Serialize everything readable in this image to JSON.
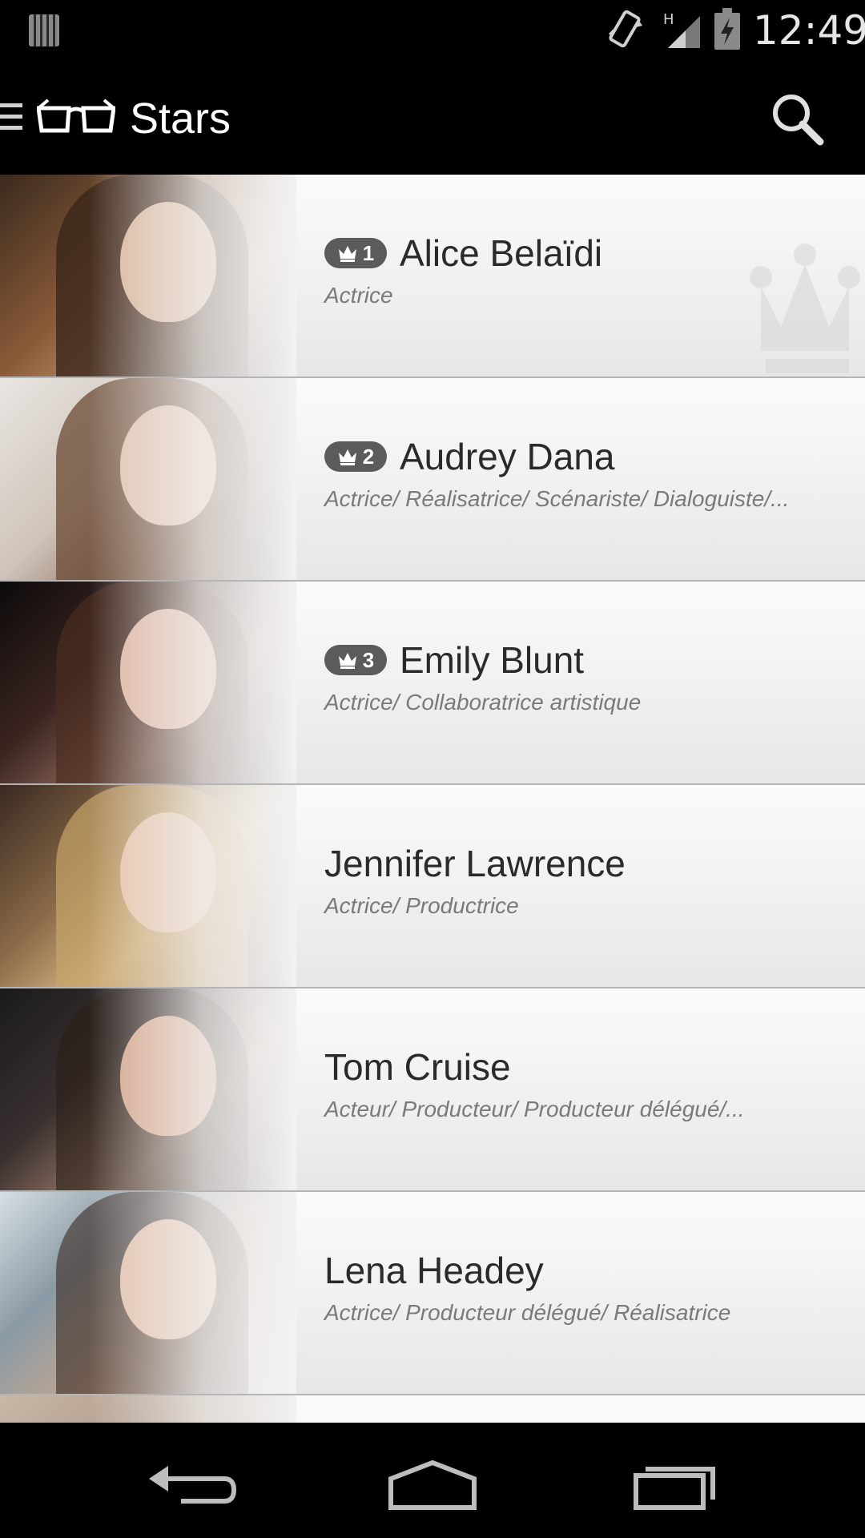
{
  "status_bar": {
    "time": "12:49",
    "network_type": "H",
    "icons": [
      "notification-icon",
      "vibrate-icon",
      "signal-icon",
      "battery-charging-icon"
    ]
  },
  "action_bar": {
    "title": "Stars",
    "icons": [
      "drawer-icon",
      "glasses-logo-icon",
      "search-icon"
    ]
  },
  "stars": [
    {
      "rank": "1",
      "name": "Alice Belaïdi",
      "job": "Actrice"
    },
    {
      "rank": "2",
      "name": "Audrey Dana",
      "job": "Actrice/ Réalisatrice/ Scénariste/ Dialoguiste/..."
    },
    {
      "rank": "3",
      "name": "Emily Blunt",
      "job": "Actrice/ Collaboratrice artistique"
    },
    {
      "rank": "",
      "name": "Jennifer Lawrence",
      "job": "Actrice/ Productrice"
    },
    {
      "rank": "",
      "name": "Tom Cruise",
      "job": "Acteur/ Producteur/ Producteur délégué/..."
    },
    {
      "rank": "",
      "name": "Lena Headey",
      "job": "Actrice/ Producteur délégué/ Réalisatrice"
    }
  ],
  "nav_bar": {
    "icons": [
      "back-icon",
      "home-icon",
      "recent-apps-icon"
    ]
  }
}
